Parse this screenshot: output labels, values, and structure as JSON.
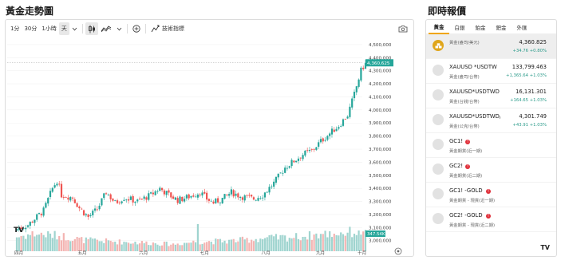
{
  "page": {
    "left_title": "黃金走勢圖",
    "right_title": "即時報價"
  },
  "toolbar": {
    "interval_1m": "1分",
    "interval_30m": "30分",
    "interval_1h": "1小時",
    "interval_day": "天",
    "indicators_label": "技術指標",
    "chevron_icon": "chevron-down-icon",
    "bar_style_icon": "candlestick-icon",
    "area_style_icon": "area-chart-icon",
    "add_icon": "plus-circle-icon",
    "camera_icon": "camera-icon"
  },
  "chart_data": {
    "type": "candlestick",
    "x_ticks": [
      "四月",
      "五月",
      "六月",
      "七月",
      "八月",
      "九月",
      "十月"
    ],
    "y_ticks": [
      "4,500,000",
      "4,400,000",
      "4,300,000",
      "4,200,000",
      "4,100,000",
      "4,000,000",
      "3,900,000",
      "3,800,000",
      "3,700,000",
      "3,600,000",
      "3,500,000",
      "3,400,000",
      "3,300,000",
      "3,200,000",
      "3,100,000",
      "3,000,000"
    ],
    "ylim": [
      2980000,
      4530000
    ],
    "last_price_label": "4,360,625",
    "volume_label": "347.54K",
    "colors": {
      "up": "#26a69a",
      "down": "#ef5350",
      "vol_up": "#9fd4cf",
      "vol_down": "#f3b4b2"
    },
    "close_anchors": [
      [
        0,
        3090000
      ],
      [
        5,
        3120000
      ],
      [
        12,
        3230000
      ],
      [
        16,
        3400000
      ],
      [
        18,
        3460000
      ],
      [
        20,
        3350000
      ],
      [
        25,
        3330000
      ],
      [
        28,
        3250000
      ],
      [
        32,
        3180000
      ],
      [
        36,
        3240000
      ],
      [
        40,
        3370000
      ],
      [
        44,
        3290000
      ],
      [
        48,
        3330000
      ],
      [
        54,
        3300000
      ],
      [
        60,
        3350000
      ],
      [
        64,
        3400000
      ],
      [
        68,
        3350000
      ],
      [
        72,
        3310000
      ],
      [
        76,
        3330000
      ],
      [
        82,
        3370000
      ],
      [
        85,
        3320000
      ],
      [
        88,
        3290000
      ],
      [
        92,
        3320000
      ],
      [
        96,
        3370000
      ],
      [
        100,
        3340000
      ],
      [
        106,
        3320000
      ],
      [
        110,
        3350000
      ],
      [
        115,
        3440000
      ],
      [
        120,
        3560000
      ],
      [
        124,
        3610000
      ],
      [
        128,
        3660000
      ],
      [
        132,
        3690000
      ],
      [
        136,
        3760000
      ],
      [
        140,
        3820000
      ],
      [
        144,
        3880000
      ],
      [
        148,
        3960000
      ],
      [
        151,
        4120000
      ],
      [
        154,
        4300000
      ],
      [
        156,
        4360625
      ]
    ],
    "volume_anchors": [
      [
        0,
        0.45
      ],
      [
        8,
        0.55
      ],
      [
        20,
        0.48
      ],
      [
        30,
        0.35
      ],
      [
        45,
        0.3
      ],
      [
        60,
        0.26
      ],
      [
        70,
        0.22
      ],
      [
        80,
        0.3
      ],
      [
        95,
        0.32
      ],
      [
        110,
        0.4
      ],
      [
        125,
        0.45
      ],
      [
        140,
        0.55
      ],
      [
        150,
        0.6
      ],
      [
        156,
        0.62
      ]
    ],
    "volume_spikes": [
      [
        81,
        0.85
      ],
      [
        153,
        0.65
      ],
      [
        155,
        0.62
      ]
    ]
  },
  "watchlist": {
    "tabs": [
      {
        "label": "黃金"
      },
      {
        "label": "白銀"
      },
      {
        "label": "鉑金"
      },
      {
        "label": "鈀金"
      },
      {
        "label": "外匯"
      }
    ],
    "items": [
      {
        "symbol": "",
        "sub": "黃金(盎司/美元)",
        "price": "4,360.825",
        "change": "+34.76  +0.80%",
        "icon": "gold-bars-icon"
      },
      {
        "symbol": "XAUUSD *USDTW",
        "sub": "黃金(盎司/台幣)",
        "price": "133,799.463",
        "change": "+1,365.64  +1.03%",
        "icon": "placeholder-circle-icon"
      },
      {
        "symbol": "XAUUSD*USDTWD",
        "sub": "黃金(台錢/台幣)",
        "price": "16,131.301",
        "change": "+164.65  +1.03%",
        "icon": "placeholder-circle-icon"
      },
      {
        "symbol": "XAUUSD*USDTWD/",
        "sub": "黃金(公克/台幣)",
        "price": "4,301.749",
        "change": "+43.91  +1.03%",
        "icon": "placeholder-circle-icon"
      },
      {
        "symbol": "GC1!",
        "sub": "黃金期貨(近一期)",
        "price": "",
        "change": "",
        "icon": "placeholder-circle-icon",
        "alert": "!"
      },
      {
        "symbol": "GC2!",
        "sub": "黃金期貨(近二期)",
        "price": "",
        "change": "",
        "icon": "placeholder-circle-icon",
        "alert": "!"
      },
      {
        "symbol": "GC1! -GOLD",
        "sub": "黃金期貨 - 現貨(近一期)",
        "price": "",
        "change": "",
        "icon": "placeholder-circle-icon",
        "alert": "!"
      },
      {
        "symbol": "GC2! -GOLD",
        "sub": "黃金期貨 - 現貨(近二期)",
        "price": "",
        "change": "",
        "icon": "placeholder-circle-icon",
        "alert": "!"
      }
    ],
    "logo": "TV"
  },
  "chart_logo": "TV"
}
